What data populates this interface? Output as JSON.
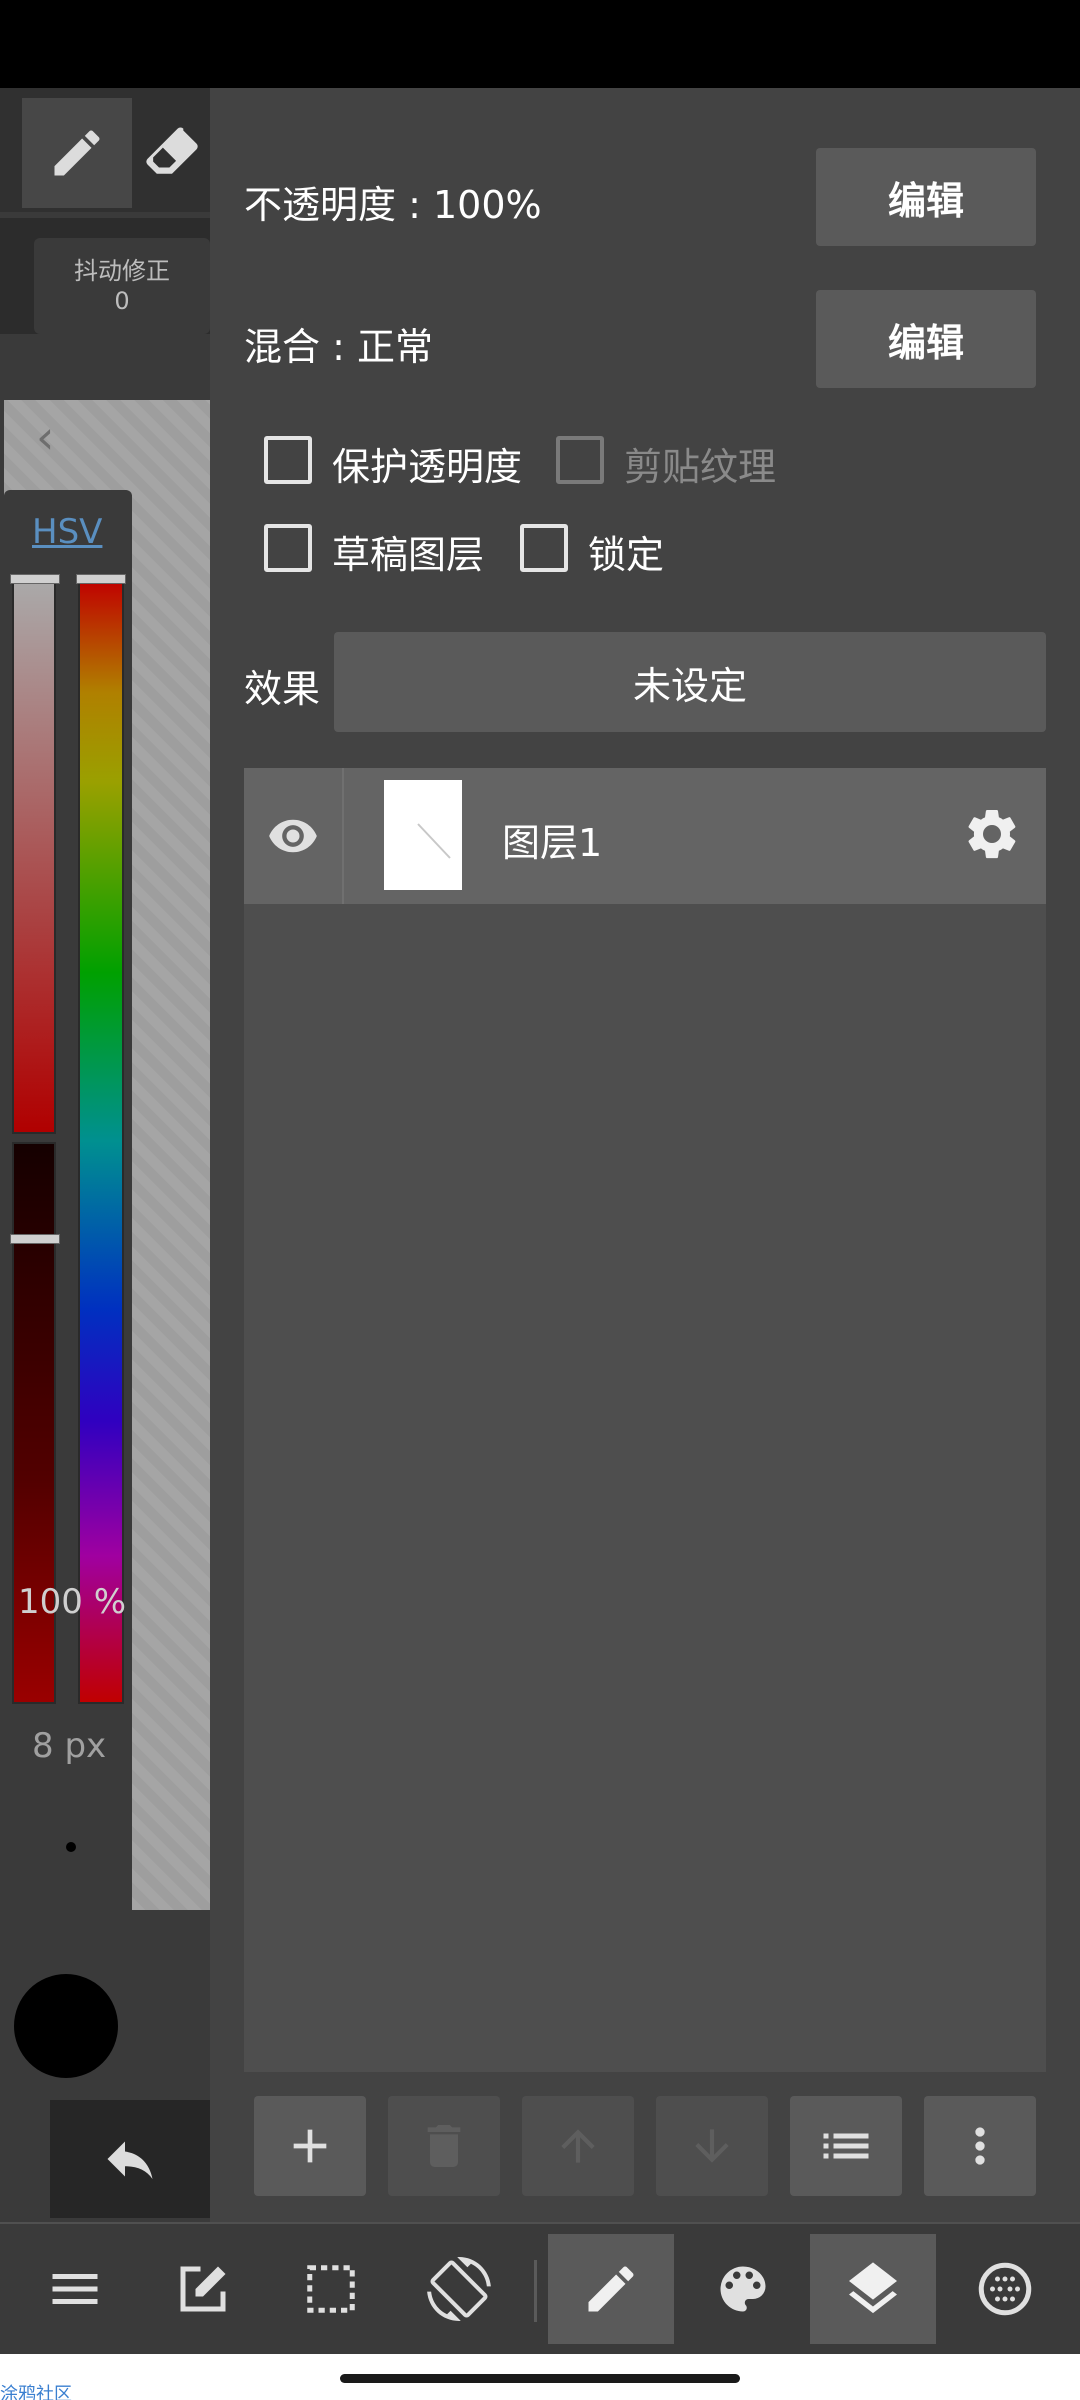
{
  "left_panel": {
    "stabilizer": {
      "label": "抖动修正",
      "value": "0"
    },
    "color_mode": "HSV",
    "brush_size": "8 px",
    "brush_opacity": "100 %",
    "color_hex": "#000000"
  },
  "layer_settings": {
    "opacity": {
      "label": "不透明度 : 100%",
      "button": "编辑"
    },
    "blend": {
      "label": "混合 : 正常",
      "button": "编辑"
    },
    "checkboxes": [
      {
        "label": "保护透明度",
        "checked": false,
        "enabled": true
      },
      {
        "label": "剪贴纹理",
        "checked": false,
        "enabled": false
      },
      {
        "label": "草稿图层",
        "checked": false,
        "enabled": true
      },
      {
        "label": "锁定",
        "checked": false,
        "enabled": true
      }
    ],
    "effect": {
      "label": "效果",
      "value": "未设定"
    }
  },
  "layers": [
    {
      "name": "图层1",
      "visible": true
    }
  ],
  "watermark": "涂鸦社区",
  "colors": {
    "panel": "#434343",
    "button": "#5a5a5a",
    "link": "#5a8fc0"
  }
}
